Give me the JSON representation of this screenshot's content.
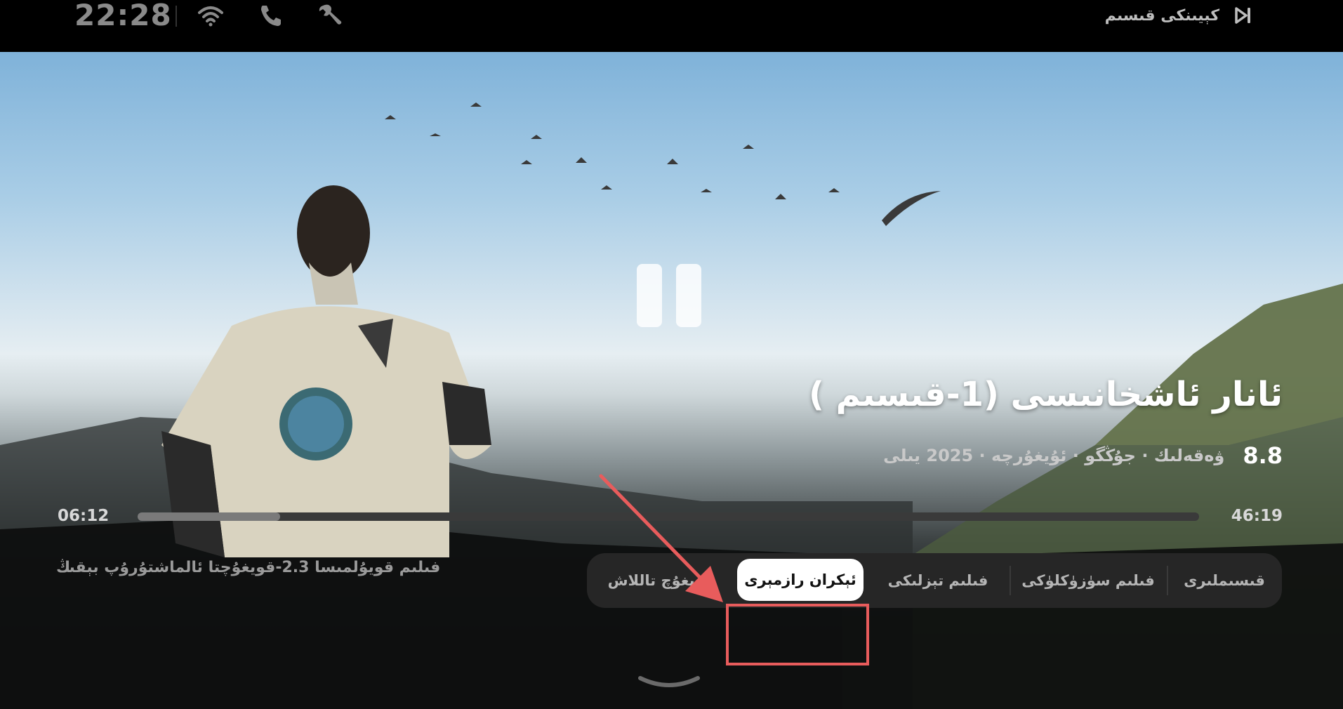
{
  "status": {
    "clock": "22:28",
    "next_episode_label": "كېيىنكى قىسىم",
    "icons": [
      "wifi-icon",
      "phone-icon",
      "wrench-icon",
      "next-episode-icon"
    ]
  },
  "video": {
    "title": "ئانار ئاشخانىسى (1-قىسىم )",
    "rating": "8.8",
    "meta": "ۋەقەلىك · جۇڭگو · ئۇيغۇرچە · 2025 يىلى",
    "current_time": "06:12",
    "duration": "46:19",
    "progress_fraction": 0.134
  },
  "controls": {
    "hint": "فىلىم قويۇلمىسا 2.3-قويغۇچتا ئالماشتۇرۇپ بېقىڭ",
    "tabs": [
      "قىسىملىرى",
      "فىلىم سۈزۈكلۈكى",
      "فىلىم تېزلىكى",
      "ئېكران رازمېرى",
      "قويغۇچ تاللاش"
    ],
    "active_tab": "ئېكران رازمېرى"
  },
  "colors": {
    "annotation": "#e85c5c",
    "tab_bg": "#262626",
    "active_tab_bg": "#ffffff"
  }
}
